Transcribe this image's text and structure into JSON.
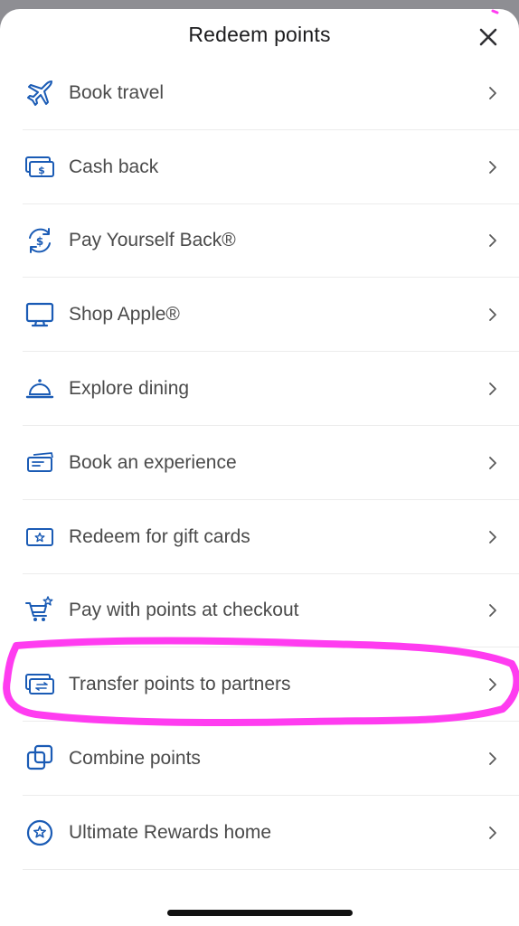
{
  "header": {
    "title": "Redeem points",
    "close_icon": "close-icon"
  },
  "colors": {
    "accent": "#1a5bb5",
    "annotation": "#ff3cf0",
    "chevron": "#5a5a5a"
  },
  "items": [
    {
      "label": "Book travel",
      "icon": "airplane-icon"
    },
    {
      "label": "Cash back",
      "icon": "cash-icon"
    },
    {
      "label": "Pay Yourself Back®",
      "icon": "refresh-dollar-icon"
    },
    {
      "label": "Shop Apple®",
      "icon": "monitor-icon"
    },
    {
      "label": "Explore dining",
      "icon": "service-bell-icon"
    },
    {
      "label": "Book an experience",
      "icon": "ticket-icon"
    },
    {
      "label": "Redeem for gift cards",
      "icon": "gift-card-icon"
    },
    {
      "label": "Pay with points at checkout",
      "icon": "cart-star-icon"
    },
    {
      "label": "Transfer points to partners",
      "icon": "transfer-card-icon",
      "highlighted": true
    },
    {
      "label": "Combine points",
      "icon": "combine-squares-icon"
    },
    {
      "label": "Ultimate Rewards home",
      "icon": "star-circle-icon"
    }
  ]
}
